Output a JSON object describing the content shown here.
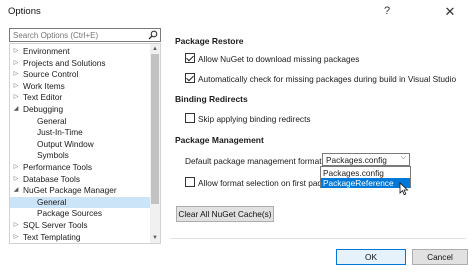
{
  "window": {
    "title": "Options",
    "help": "?",
    "close": "✕"
  },
  "search": {
    "placeholder": "Search Options (Ctrl+E)"
  },
  "tree": [
    {
      "label": "Environment",
      "arrow": "▷",
      "level": 0
    },
    {
      "label": "Projects and Solutions",
      "arrow": "▷",
      "level": 0
    },
    {
      "label": "Source Control",
      "arrow": "▷",
      "level": 0
    },
    {
      "label": "Work Items",
      "arrow": "▷",
      "level": 0
    },
    {
      "label": "Text Editor",
      "arrow": "▷",
      "level": 0
    },
    {
      "label": "Debugging",
      "arrow": "◢",
      "level": 0
    },
    {
      "label": "General",
      "arrow": "",
      "level": 1
    },
    {
      "label": "Just-In-Time",
      "arrow": "",
      "level": 1
    },
    {
      "label": "Output Window",
      "arrow": "",
      "level": 1
    },
    {
      "label": "Symbols",
      "arrow": "",
      "level": 1
    },
    {
      "label": "Performance Tools",
      "arrow": "▷",
      "level": 0
    },
    {
      "label": "Database Tools",
      "arrow": "▷",
      "level": 0
    },
    {
      "label": "NuGet Package Manager",
      "arrow": "◢",
      "level": 0
    },
    {
      "label": "General",
      "arrow": "",
      "level": 1,
      "selected": true
    },
    {
      "label": "Package Sources",
      "arrow": "",
      "level": 1
    },
    {
      "label": "SQL Server Tools",
      "arrow": "▷",
      "level": 0
    },
    {
      "label": "Text Templating",
      "arrow": "▷",
      "level": 0
    },
    {
      "label": "Web Forms Designer",
      "arrow": "▷",
      "level": 0
    }
  ],
  "restore": {
    "heading": "Package Restore",
    "allow_label": "Allow NuGet to download missing packages",
    "allow_checked": true,
    "auto_label": "Automatically check for missing packages during build in Visual Studio",
    "auto_checked": true
  },
  "binding": {
    "heading": "Binding Redirects",
    "skip_label": "Skip applying binding redirects",
    "skip_checked": false
  },
  "management": {
    "heading": "Package Management",
    "format_label": "Default package management format:",
    "format_value": "Packages.config",
    "format_options": [
      "Packages.config",
      "PackageReference"
    ],
    "highlighted_option": "PackageReference",
    "allow_format_label": "Allow format selection on first packag",
    "allow_format_checked": false
  },
  "clear_cache_label": "Clear All NuGet Cache(s)",
  "buttons": {
    "ok": "OK",
    "cancel": "Cancel"
  },
  "colors": {
    "accent": "#0078d7",
    "selection": "#cce4f7"
  }
}
